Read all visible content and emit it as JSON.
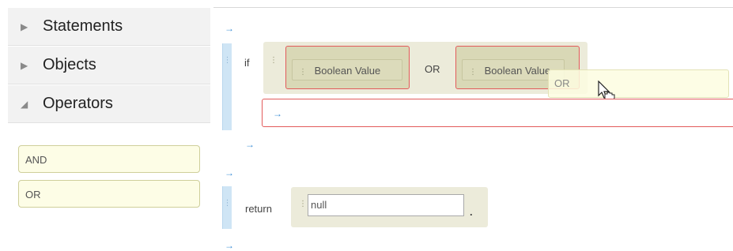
{
  "palette": {
    "categories": [
      {
        "label": "Statements",
        "expanded": false
      },
      {
        "label": "Objects",
        "expanded": false
      },
      {
        "label": "Operators",
        "expanded": true
      }
    ],
    "operator_blocks": [
      "AND",
      "OR"
    ]
  },
  "canvas": {
    "if_keyword": "if",
    "condition": {
      "left": "Boolean Value",
      "operator": "OR",
      "right": "Boolean Value"
    },
    "drag_ghost_label": "OR",
    "return_keyword": "return",
    "return_value": "null",
    "statement_terminator": ".",
    "insert_arrow": "→"
  },
  "colors": {
    "error_outline": "#e25b5b",
    "insert_arrow": "#3d8fd6",
    "block_bg": "#ecebda",
    "palette_block_bg": "#fdfde6"
  }
}
